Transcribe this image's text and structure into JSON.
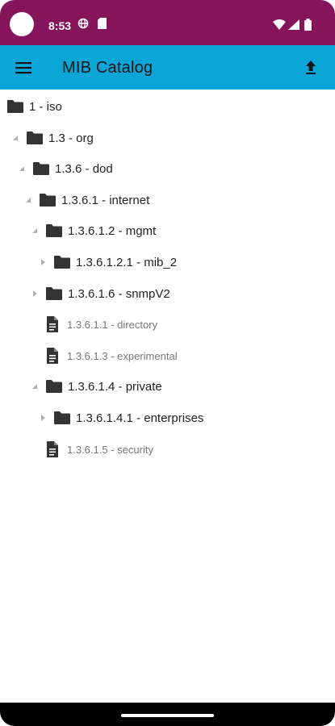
{
  "status_bar": {
    "time": "8:53",
    "icons": [
      "globe-icon",
      "sim-icon",
      "wifi-icon",
      "signal-icon",
      "battery-icon"
    ]
  },
  "app_bar": {
    "title": "MIB Catalog",
    "menu_icon": "menu-icon",
    "action_icon": "upload-icon"
  },
  "colors": {
    "status_bar": "#86145a",
    "app_bar": "#0aa6d8",
    "folder": "#333333",
    "file_text": "#777777"
  },
  "tree": [
    {
      "label": "1 - iso",
      "type": "folder",
      "depth": 0,
      "arrow": "none"
    },
    {
      "label": "1.3 - org",
      "type": "folder",
      "depth": 1,
      "arrow": "expanded"
    },
    {
      "label": "1.3.6 - dod",
      "type": "folder",
      "depth": 2,
      "arrow": "expanded"
    },
    {
      "label": "1.3.6.1 - internet",
      "type": "folder",
      "depth": 3,
      "arrow": "expanded"
    },
    {
      "label": "1.3.6.1.2 - mgmt",
      "type": "folder",
      "depth": 4,
      "arrow": "expanded"
    },
    {
      "label": "1.3.6.1.2.1 - mib_2",
      "type": "folder",
      "depth": 5,
      "arrow": "collapsed"
    },
    {
      "label": "1.3.6.1.6 - snmpV2",
      "type": "folder",
      "depth": 4,
      "arrow": "collapsed"
    },
    {
      "label": "1.3.6.1.1 - directory",
      "type": "file",
      "depth": 4,
      "arrow": "none"
    },
    {
      "label": "1.3.6.1.3 - experimental",
      "type": "file",
      "depth": 4,
      "arrow": "none"
    },
    {
      "label": "1.3.6.1.4 - private",
      "type": "folder",
      "depth": 4,
      "arrow": "expanded"
    },
    {
      "label": "1.3.6.1.4.1 - enterprises",
      "type": "folder",
      "depth": 5,
      "arrow": "collapsed"
    },
    {
      "label": "1.3.6.1.5 - security",
      "type": "file",
      "depth": 4,
      "arrow": "none"
    }
  ]
}
